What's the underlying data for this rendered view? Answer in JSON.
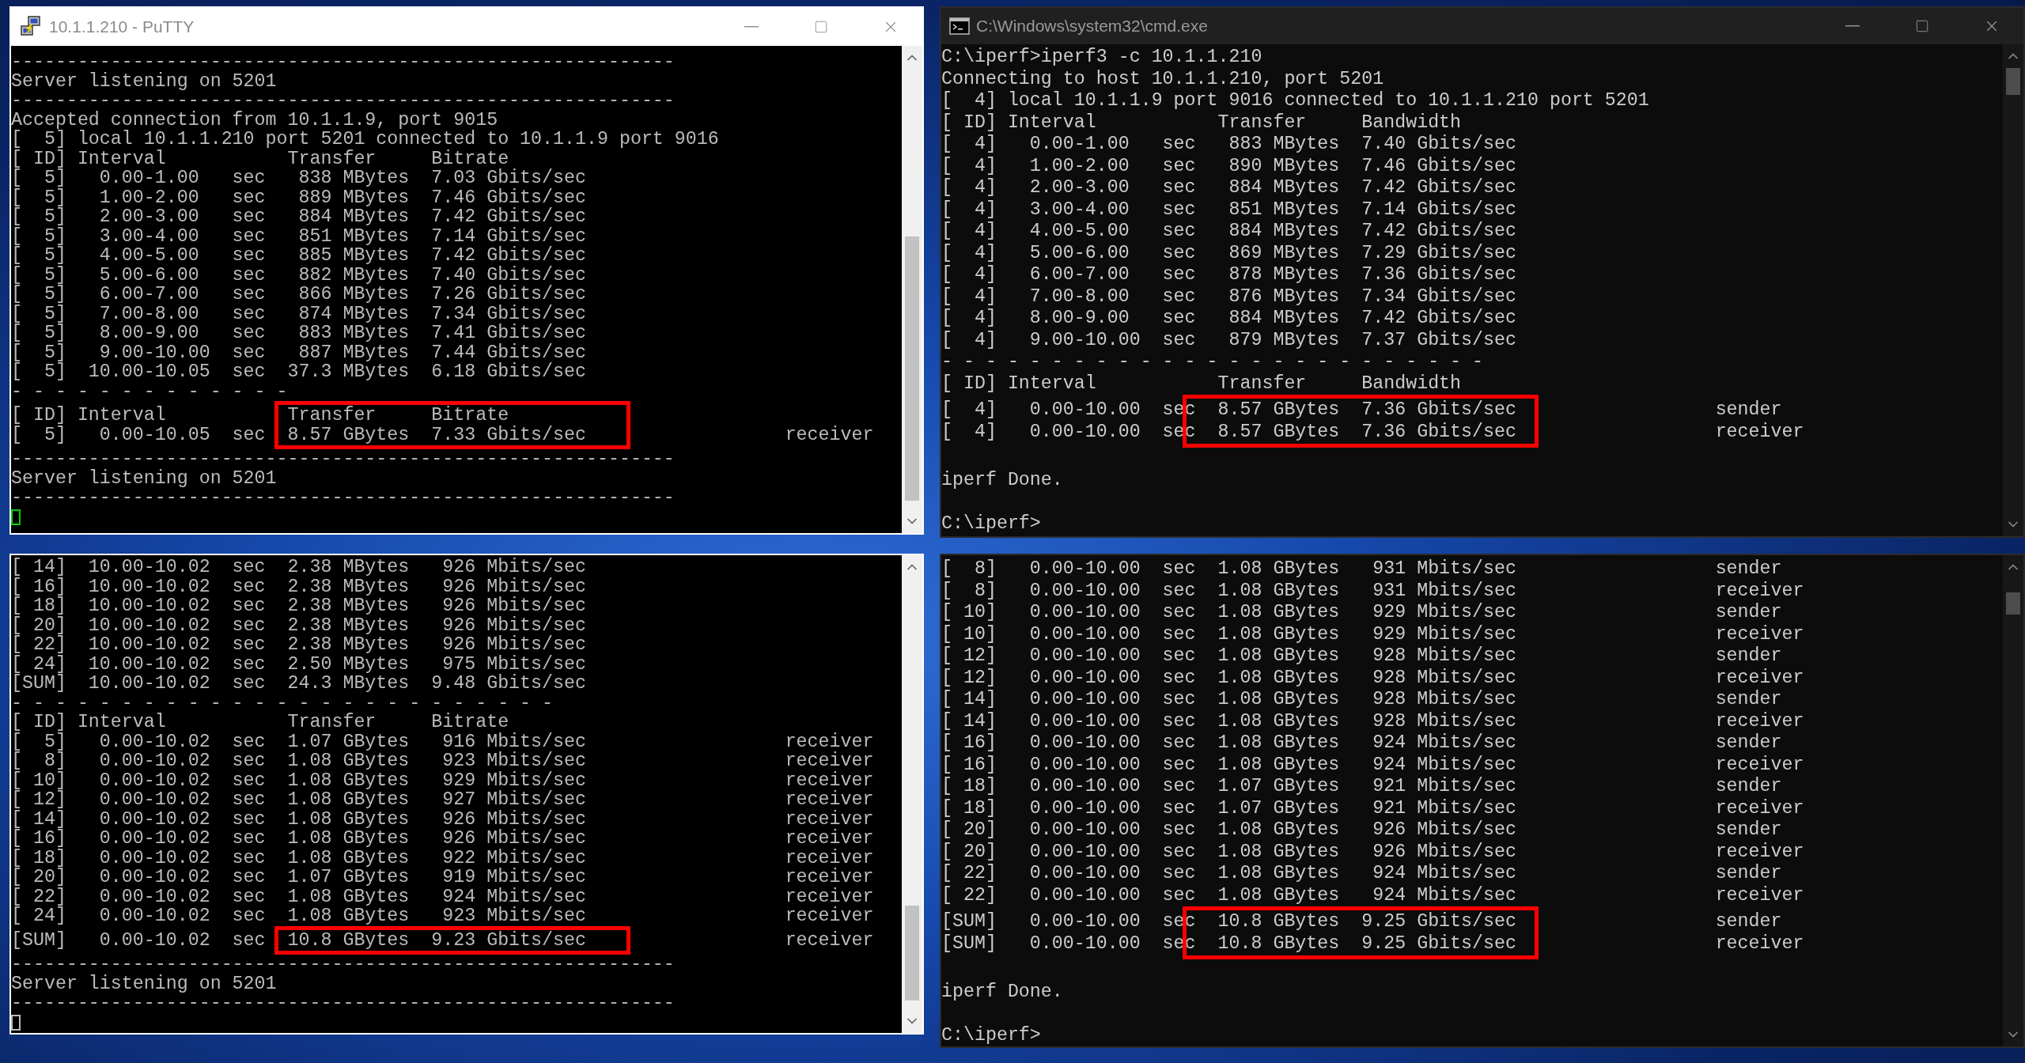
{
  "terminals": [
    {
      "kind": "putty",
      "title": "10.1.1.210 - PuTTY",
      "cursor": {
        "focused": true
      },
      "lines": [
        {
          "text": "------------------------------------------------------------",
          "highlighted": false
        },
        {
          "text": "Server listening on 5201",
          "highlighted": false
        },
        {
          "text": "------------------------------------------------------------",
          "highlighted": false
        },
        {
          "text": "Accepted connection from 10.1.1.9, port 9015",
          "highlighted": false
        },
        {
          "text": "[  5] local 10.1.1.210 port 5201 connected to 10.1.1.9 port 9016",
          "highlighted": false
        },
        {
          "text": "[ ID] Interval           Transfer     Bitrate",
          "highlighted": false
        },
        {
          "text": "[  5]   0.00-1.00   sec   838 MBytes  7.03 Gbits/sec",
          "highlighted": false
        },
        {
          "text": "[  5]   1.00-2.00   sec   889 MBytes  7.46 Gbits/sec",
          "highlighted": false
        },
        {
          "text": "[  5]   2.00-3.00   sec   884 MBytes  7.42 Gbits/sec",
          "highlighted": false
        },
        {
          "text": "[  5]   3.00-4.00   sec   851 MBytes  7.14 Gbits/sec",
          "highlighted": false
        },
        {
          "text": "[  5]   4.00-5.00   sec   885 MBytes  7.42 Gbits/sec",
          "highlighted": false
        },
        {
          "text": "[  5]   5.00-6.00   sec   882 MBytes  7.40 Gbits/sec",
          "highlighted": false
        },
        {
          "text": "[  5]   6.00-7.00   sec   866 MBytes  7.26 Gbits/sec",
          "highlighted": false
        },
        {
          "text": "[  5]   7.00-8.00   sec   874 MBytes  7.34 Gbits/sec",
          "highlighted": false
        },
        {
          "text": "[  5]   8.00-9.00   sec   883 MBytes  7.41 Gbits/sec",
          "highlighted": false
        },
        {
          "text": "[  5]   9.00-10.00  sec   887 MBytes  7.44 Gbits/sec",
          "highlighted": false
        },
        {
          "text": "[  5]  10.00-10.05  sec  37.3 MBytes  6.18 Gbits/sec",
          "highlighted": false
        },
        {
          "text": "- - - - - - - - - - - - -",
          "highlighted": false
        },
        {
          "text": "[ ID] Interval           Transfer     Bitrate",
          "highlighted": true
        },
        {
          "text": "[  5]   0.00-10.05  sec  8.57 GBytes  7.33 Gbits/sec                  receiver",
          "highlighted": true
        },
        {
          "text": "------------------------------------------------------------",
          "highlighted": false
        },
        {
          "text": "Server listening on 5201",
          "highlighted": false
        },
        {
          "text": "------------------------------------------------------------",
          "highlighted": false
        }
      ]
    },
    {
      "kind": "cmd",
      "title": "C:\\Windows\\system32\\cmd.exe",
      "lines": [
        {
          "text": "C:\\iperf>iperf3 -c 10.1.1.210",
          "highlighted": false
        },
        {
          "text": "Connecting to host 10.1.1.210, port 5201",
          "highlighted": false
        },
        {
          "text": "[  4] local 10.1.1.9 port 9016 connected to 10.1.1.210 port 5201",
          "highlighted": false
        },
        {
          "text": "[ ID] Interval           Transfer     Bandwidth",
          "highlighted": false
        },
        {
          "text": "[  4]   0.00-1.00   sec   883 MBytes  7.40 Gbits/sec",
          "highlighted": false
        },
        {
          "text": "[  4]   1.00-2.00   sec   890 MBytes  7.46 Gbits/sec",
          "highlighted": false
        },
        {
          "text": "[  4]   2.00-3.00   sec   884 MBytes  7.42 Gbits/sec",
          "highlighted": false
        },
        {
          "text": "[  4]   3.00-4.00   sec   851 MBytes  7.14 Gbits/sec",
          "highlighted": false
        },
        {
          "text": "[  4]   4.00-5.00   sec   884 MBytes  7.42 Gbits/sec",
          "highlighted": false
        },
        {
          "text": "[  4]   5.00-6.00   sec   869 MBytes  7.29 Gbits/sec",
          "highlighted": false
        },
        {
          "text": "[  4]   6.00-7.00   sec   878 MBytes  7.36 Gbits/sec",
          "highlighted": false
        },
        {
          "text": "[  4]   7.00-8.00   sec   876 MBytes  7.34 Gbits/sec",
          "highlighted": false
        },
        {
          "text": "[  4]   8.00-9.00   sec   884 MBytes  7.42 Gbits/sec",
          "highlighted": false
        },
        {
          "text": "[  4]   9.00-10.00  sec   879 MBytes  7.37 Gbits/sec",
          "highlighted": false
        },
        {
          "text": "- - - - - - - - - - - - - - - - - - - - - - - - -",
          "highlighted": false
        },
        {
          "text": "[ ID] Interval           Transfer     Bandwidth",
          "highlighted": false
        },
        {
          "text": "[  4]   0.00-10.00  sec  8.57 GBytes  7.36 Gbits/sec                  sender",
          "highlighted": true
        },
        {
          "text": "[  4]   0.00-10.00  sec  8.57 GBytes  7.36 Gbits/sec                  receiver",
          "highlighted": true
        },
        {
          "highlighted": false
        },
        {
          "text": "iperf Done.",
          "highlighted": false
        },
        {
          "highlighted": false
        },
        {
          "text": "C:\\iperf>",
          "highlighted": false
        }
      ]
    },
    {
      "kind": "putty",
      "cursor": {
        "focused": false
      },
      "lines": [
        {
          "text": "[ 14]  10.00-10.02  sec  2.38 MBytes   926 Mbits/sec",
          "highlighted": false
        },
        {
          "text": "[ 16]  10.00-10.02  sec  2.38 MBytes   926 Mbits/sec",
          "highlighted": false
        },
        {
          "text": "[ 18]  10.00-10.02  sec  2.38 MBytes   926 Mbits/sec",
          "highlighted": false
        },
        {
          "text": "[ 20]  10.00-10.02  sec  2.38 MBytes   926 Mbits/sec",
          "highlighted": false
        },
        {
          "text": "[ 22]  10.00-10.02  sec  2.38 MBytes   926 Mbits/sec",
          "highlighted": false
        },
        {
          "text": "[ 24]  10.00-10.02  sec  2.50 MBytes   975 Mbits/sec",
          "highlighted": false
        },
        {
          "text": "[SUM]  10.00-10.02  sec  24.3 MBytes  9.48 Gbits/sec",
          "highlighted": false
        },
        {
          "text": "- - - - - - - - - - - - - - - - - - - - - - - - -",
          "highlighted": false
        },
        {
          "text": "[ ID] Interval           Transfer     Bitrate",
          "highlighted": false
        },
        {
          "text": "[  5]   0.00-10.02  sec  1.07 GBytes   916 Mbits/sec                  receiver",
          "highlighted": false
        },
        {
          "text": "[  8]   0.00-10.02  sec  1.08 GBytes   923 Mbits/sec                  receiver",
          "highlighted": false
        },
        {
          "text": "[ 10]   0.00-10.02  sec  1.08 GBytes   929 Mbits/sec                  receiver",
          "highlighted": false
        },
        {
          "text": "[ 12]   0.00-10.02  sec  1.08 GBytes   927 Mbits/sec                  receiver",
          "highlighted": false
        },
        {
          "text": "[ 14]   0.00-10.02  sec  1.08 GBytes   926 Mbits/sec                  receiver",
          "highlighted": false
        },
        {
          "text": "[ 16]   0.00-10.02  sec  1.08 GBytes   926 Mbits/sec                  receiver",
          "highlighted": false
        },
        {
          "text": "[ 18]   0.00-10.02  sec  1.08 GBytes   922 Mbits/sec                  receiver",
          "highlighted": false
        },
        {
          "text": "[ 20]   0.00-10.02  sec  1.07 GBytes   919 Mbits/sec                  receiver",
          "highlighted": false
        },
        {
          "text": "[ 22]   0.00-10.02  sec  1.08 GBytes   924 Mbits/sec                  receiver",
          "highlighted": false
        },
        {
          "text": "[ 24]   0.00-10.02  sec  1.08 GBytes   923 Mbits/sec                  receiver",
          "highlighted": false
        },
        {
          "text": "[SUM]   0.00-10.02  sec  10.8 GBytes  9.23 Gbits/sec                  receiver",
          "highlighted": true
        },
        {
          "text": "------------------------------------------------------------",
          "highlighted": false
        },
        {
          "text": "Server listening on 5201",
          "highlighted": false
        },
        {
          "text": "------------------------------------------------------------",
          "highlighted": false
        }
      ]
    },
    {
      "kind": "cmd",
      "lines": [
        {
          "text": "[  8]   0.00-10.00  sec  1.08 GBytes   931 Mbits/sec                  sender",
          "highlighted": false
        },
        {
          "text": "[  8]   0.00-10.00  sec  1.08 GBytes   931 Mbits/sec                  receiver",
          "highlighted": false
        },
        {
          "text": "[ 10]   0.00-10.00  sec  1.08 GBytes   929 Mbits/sec                  sender",
          "highlighted": false
        },
        {
          "text": "[ 10]   0.00-10.00  sec  1.08 GBytes   929 Mbits/sec                  receiver",
          "highlighted": false
        },
        {
          "text": "[ 12]   0.00-10.00  sec  1.08 GBytes   928 Mbits/sec                  sender",
          "highlighted": false
        },
        {
          "text": "[ 12]   0.00-10.00  sec  1.08 GBytes   928 Mbits/sec                  receiver",
          "highlighted": false
        },
        {
          "text": "[ 14]   0.00-10.00  sec  1.08 GBytes   928 Mbits/sec                  sender",
          "highlighted": false
        },
        {
          "text": "[ 14]   0.00-10.00  sec  1.08 GBytes   928 Mbits/sec                  receiver",
          "highlighted": false
        },
        {
          "text": "[ 16]   0.00-10.00  sec  1.08 GBytes   924 Mbits/sec                  sender",
          "highlighted": false
        },
        {
          "text": "[ 16]   0.00-10.00  sec  1.08 GBytes   924 Mbits/sec                  receiver",
          "highlighted": false
        },
        {
          "text": "[ 18]   0.00-10.00  sec  1.07 GBytes   921 Mbits/sec                  sender",
          "highlighted": false
        },
        {
          "text": "[ 18]   0.00-10.00  sec  1.07 GBytes   921 Mbits/sec                  receiver",
          "highlighted": false
        },
        {
          "text": "[ 20]   0.00-10.00  sec  1.08 GBytes   926 Mbits/sec                  sender",
          "highlighted": false
        },
        {
          "text": "[ 20]   0.00-10.00  sec  1.08 GBytes   926 Mbits/sec                  receiver",
          "highlighted": false
        },
        {
          "text": "[ 22]   0.00-10.00  sec  1.08 GBytes   924 Mbits/sec                  sender",
          "highlighted": false
        },
        {
          "text": "[ 22]   0.00-10.00  sec  1.08 GBytes   924 Mbits/sec                  receiver",
          "highlighted": false
        },
        {
          "text": "[SUM]   0.00-10.00  sec  10.8 GBytes  9.25 Gbits/sec                  sender",
          "highlighted": true
        },
        {
          "text": "[SUM]   0.00-10.00  sec  10.8 GBytes  9.25 Gbits/sec                  receiver",
          "highlighted": true
        },
        {
          "highlighted": false
        },
        {
          "text": "iperf Done.",
          "highlighted": false
        },
        {
          "highlighted": false
        },
        {
          "text": "C:\\iperf>",
          "highlighted": false
        }
      ]
    }
  ]
}
